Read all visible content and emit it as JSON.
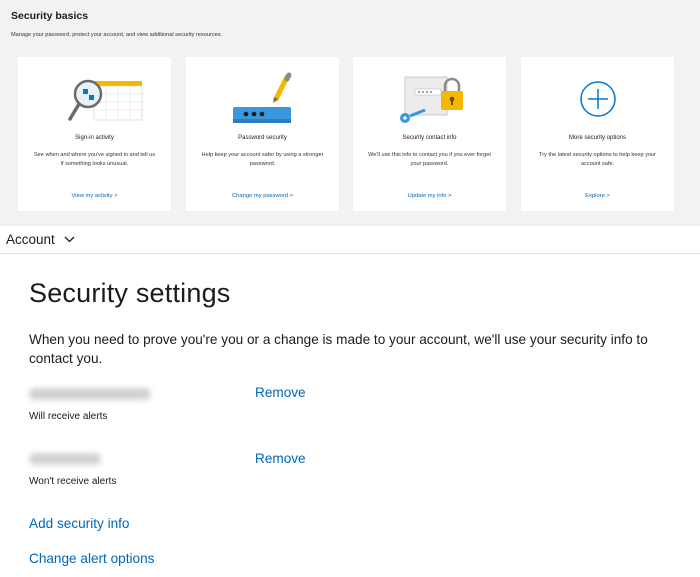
{
  "security_basics": {
    "title": "Security basics",
    "subtitle": "Manage your password, protect your account, and view additional security resources.",
    "cards": [
      {
        "title": "Sign-in activity",
        "description": "See when and where you've signed in and tell us if something looks unusual.",
        "link": "View my activity >",
        "icon": "magnifier-calendar-illustration"
      },
      {
        "title": "Password security",
        "description": "Help keep your account safer by using a stronger password.",
        "link": "Change my password >",
        "icon": "password-pen-illustration"
      },
      {
        "title": "Security contact info",
        "description": "We'll use this info to contact you if you ever forget your password.",
        "link": "Update my info >",
        "icon": "key-lock-illustration"
      },
      {
        "title": "More security options",
        "description": "Try the latest security options to help keep your account safe.",
        "link": "Explore >",
        "icon": "plus-circle-icon"
      }
    ]
  },
  "account_menu": {
    "label": "Account"
  },
  "security_settings": {
    "title": "Security settings",
    "intro": "When you need to prove you're you or a change is made to your account, we'll use your security info to contact you.",
    "items": [
      {
        "remove_label": "Remove",
        "alert_text": "Will receive alerts"
      },
      {
        "remove_label": "Remove",
        "alert_text": "Won't receive alerts"
      }
    ],
    "add_security_info": "Add security info",
    "change_alert_options": "Change alert options"
  },
  "colors": {
    "accent": "#0067b8",
    "card_bg": "#ffffff",
    "top_bg": "#f2f2f2"
  }
}
